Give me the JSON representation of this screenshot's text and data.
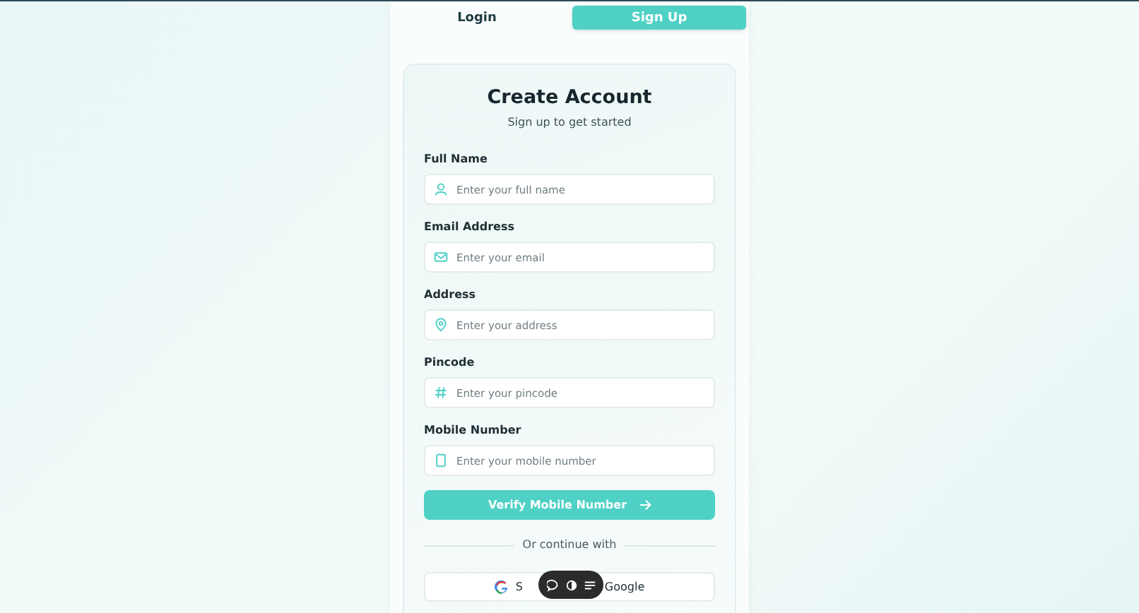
{
  "tabs": [
    {
      "label": "Login",
      "selected": false
    },
    {
      "label": "Sign Up",
      "selected": true
    }
  ],
  "form": {
    "title": "Create Account",
    "subtitle": "Sign up to get started",
    "fields": [
      {
        "label": "Full Name",
        "kind": "person",
        "placeholder": "Enter your full name"
      },
      {
        "label": "Email Address",
        "kind": "mail",
        "placeholder": "Enter your email"
      },
      {
        "label": "Address",
        "kind": "pin",
        "placeholder": "Enter your address"
      },
      {
        "label": "Pincode",
        "kind": "hash",
        "placeholder": "Enter your pincode"
      },
      {
        "label": "Mobile Number",
        "kind": "phone",
        "placeholder": "Enter your mobile number"
      }
    ],
    "submit": "Verify Mobile Number",
    "divider": "Or continue with",
    "google_button": [
      "S",
      "Google"
    ]
  }
}
